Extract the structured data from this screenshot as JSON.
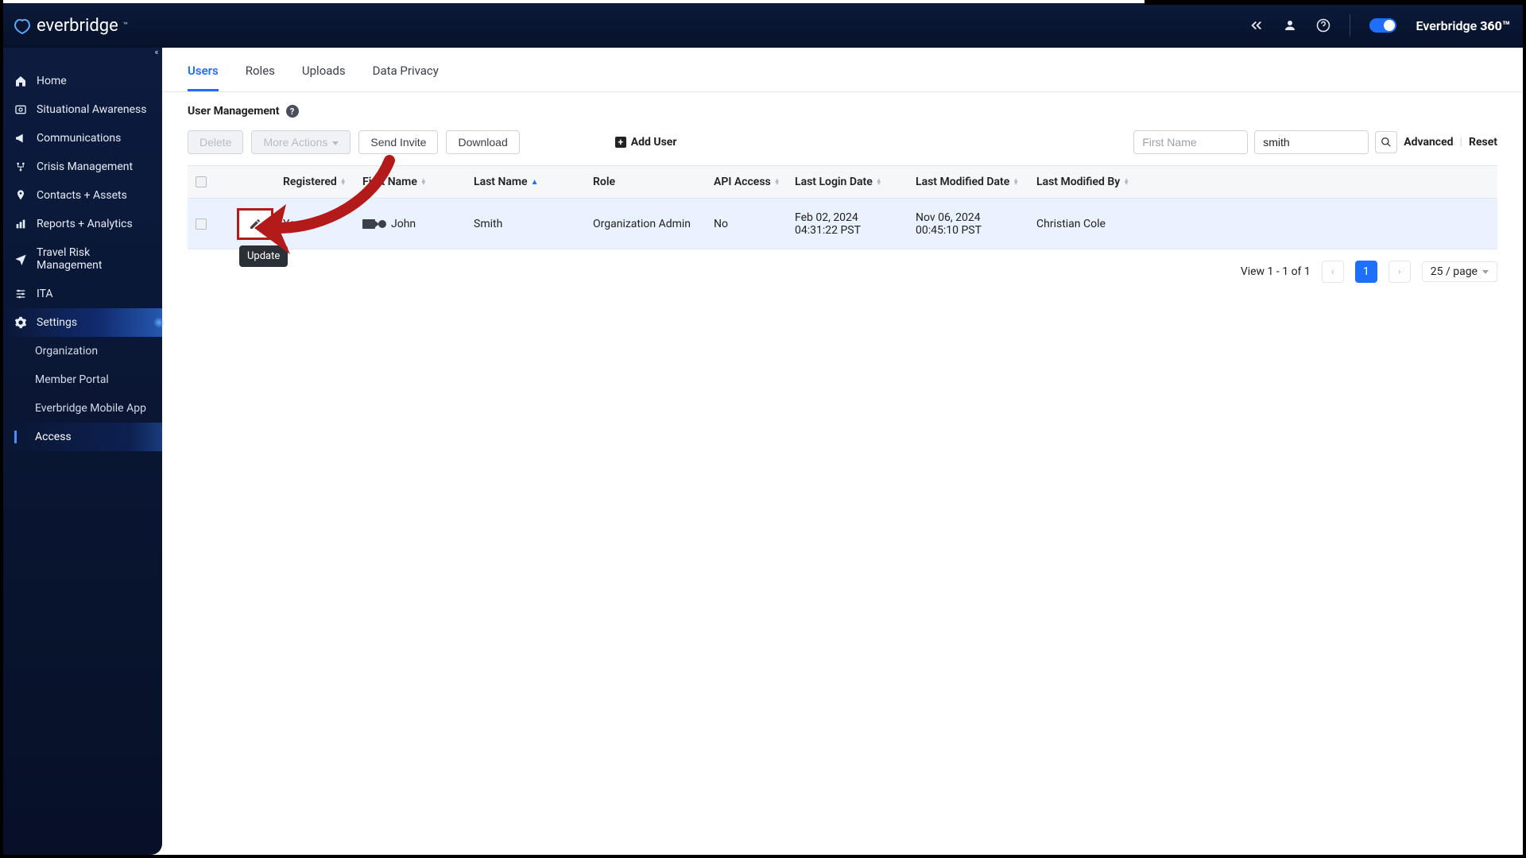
{
  "brand": {
    "name": "everbridge",
    "suite": "Everbridge",
    "suite_bold": "360™"
  },
  "sidebar": {
    "items": [
      {
        "label": "Home"
      },
      {
        "label": "Situational Awareness"
      },
      {
        "label": "Communications"
      },
      {
        "label": "Crisis Management"
      },
      {
        "label": "Contacts + Assets"
      },
      {
        "label": "Reports + Analytics"
      },
      {
        "label": "Travel Risk Management"
      },
      {
        "label": "ITA"
      },
      {
        "label": "Settings"
      }
    ],
    "sub": [
      {
        "label": "Organization"
      },
      {
        "label": "Member Portal"
      },
      {
        "label": "Everbridge Mobile App"
      },
      {
        "label": "Access"
      }
    ]
  },
  "tabs": [
    {
      "label": "Users"
    },
    {
      "label": "Roles"
    },
    {
      "label": "Uploads"
    },
    {
      "label": "Data Privacy"
    }
  ],
  "page": {
    "title": "User Management"
  },
  "toolbar": {
    "delete": "Delete",
    "more": "More Actions",
    "send_invite": "Send Invite",
    "download": "Download",
    "add_user": "Add User",
    "fn_placeholder": "First Name",
    "ln_value": "smith",
    "advanced": "Advanced",
    "reset": "Reset"
  },
  "table": {
    "columns": {
      "registered": "Registered",
      "first_name": "First Name",
      "last_name": "Last Name",
      "role": "Role",
      "api_access": "API Access",
      "last_login": "Last Login Date",
      "last_modified": "Last Modified Date",
      "modified_by": "Last Modified By"
    },
    "rows": [
      {
        "registered": "Yes",
        "first_name": "John",
        "last_name": "Smith",
        "role": "Organization Admin",
        "api_access": "No",
        "last_login": "Feb 02, 2024 04:31:22 PST",
        "last_modified": "Nov 06, 2024 00:45:10 PST",
        "modified_by": "Christian Cole"
      }
    ]
  },
  "tooltip": {
    "update": "Update"
  },
  "pagination": {
    "summary": "View 1 - 1 of 1",
    "page": "1",
    "size": "25 / page"
  }
}
